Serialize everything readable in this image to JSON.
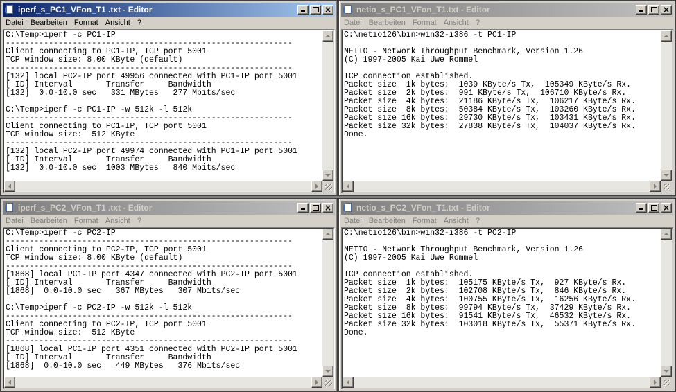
{
  "menu": [
    "Datei",
    "Bearbeiten",
    "Format",
    "Ansicht",
    "?"
  ],
  "windows": [
    {
      "title": "iperf_s_PC1_VFon_T1 .txt - Editor",
      "active": true,
      "content": "C:\\Temp>iperf -c PC1-IP\n------------------------------------------------------------\nClient connecting to PC1-IP, TCP port 5001\nTCP window size: 8.00 KByte (default)\n------------------------------------------------------------\n[132] local PC2-IP port 49956 connected with PC1-IP port 5001\n[ ID] Interval       Transfer     Bandwidth\n[132]  0.0-10.0 sec   331 MBytes   277 Mbits/sec\n\nC:\\Temp>iperf -c PC1-IP -w 512k -l 512k\n------------------------------------------------------------\nClient connecting to PC1-IP, TCP port 5001\nTCP window size:  512 KByte\n------------------------------------------------------------\n[132] local PC2-IP port 49974 connected with PC1-IP port 5001\n[ ID] Interval       Transfer     Bandwidth\n[132]  0.0-10.0 sec  1003 MBytes   840 Mbits/sec"
    },
    {
      "title": "netio_s_PC1_VFon_T1.txt - Editor",
      "active": false,
      "content": "C:\\netio126\\bin>win32-i386 -t PC1-IP\n\nNETIO - Network Throughput Benchmark, Version 1.26\n(C) 1997-2005 Kai Uwe Rommel\n\nTCP connection established.\nPacket size  1k bytes:  1039 KByte/s Tx,  105349 KByte/s Rx.\nPacket size  2k bytes:  991 KByte/s Tx,  106710 KByte/s Rx.\nPacket size  4k bytes:  21186 KByte/s Tx,  106217 KByte/s Rx.\nPacket size  8k bytes:  50384 KByte/s Tx,  103260 KByte/s Rx.\nPacket size 16k bytes:  29730 KByte/s Tx,  103431 KByte/s Rx.\nPacket size 32k bytes:  27838 KByte/s Tx,  104037 KByte/s Rx.\nDone."
    },
    {
      "title": "iperf_s_PC2_VFon_T1 .txt - Editor",
      "active": false,
      "content": "C:\\Temp>iperf -c PC2-IP\n------------------------------------------------------------\nClient connecting to PC2-IP, TCP port 5001\nTCP window size: 8.00 KByte (default)\n------------------------------------------------------------\n[1868] local PC1-IP port 4347 connected with PC2-IP port 5001\n[ ID] Interval       Transfer     Bandwidth\n[1868]  0.0-10.0 sec   367 MBytes   307 Mbits/sec\n\nC:\\Temp>iperf -c PC2-IP -w 512k -l 512k\n------------------------------------------------------------\nClient connecting to PC2-IP, TCP port 5001\nTCP window size:  512 KByte\n------------------------------------------------------------\n[1868] local PC1-IP port 4351 connected with PC2-IP port 5001\n[ ID] Interval       Transfer     Bandwidth\n[1868]  0.0-10.0 sec   449 MBytes   376 Mbits/sec"
    },
    {
      "title": "netio_s_PC2_VFon_T1.txt - Editor",
      "active": false,
      "content": "C:\\netio126\\bin>win32-i386 -t PC2-IP\n\nNETIO - Network Throughput Benchmark, Version 1.26\n(C) 1997-2005 Kai Uwe Rommel\n\nTCP connection established.\nPacket size  1k bytes:  105175 KByte/s Tx,  927 KByte/s Rx.\nPacket size  2k bytes:  102708 KByte/s Tx,  846 KByte/s Rx.\nPacket size  4k bytes:  100755 KByte/s Tx,  16256 KByte/s Rx.\nPacket size  8k bytes:  99794 KByte/s Tx,  37429 KByte/s Rx.\nPacket size 16k bytes:  91541 KByte/s Tx,  46532 KByte/s Rx.\nPacket size 32k bytes:  103018 KByte/s Tx,  55371 KByte/s Rx.\nDone."
    }
  ]
}
